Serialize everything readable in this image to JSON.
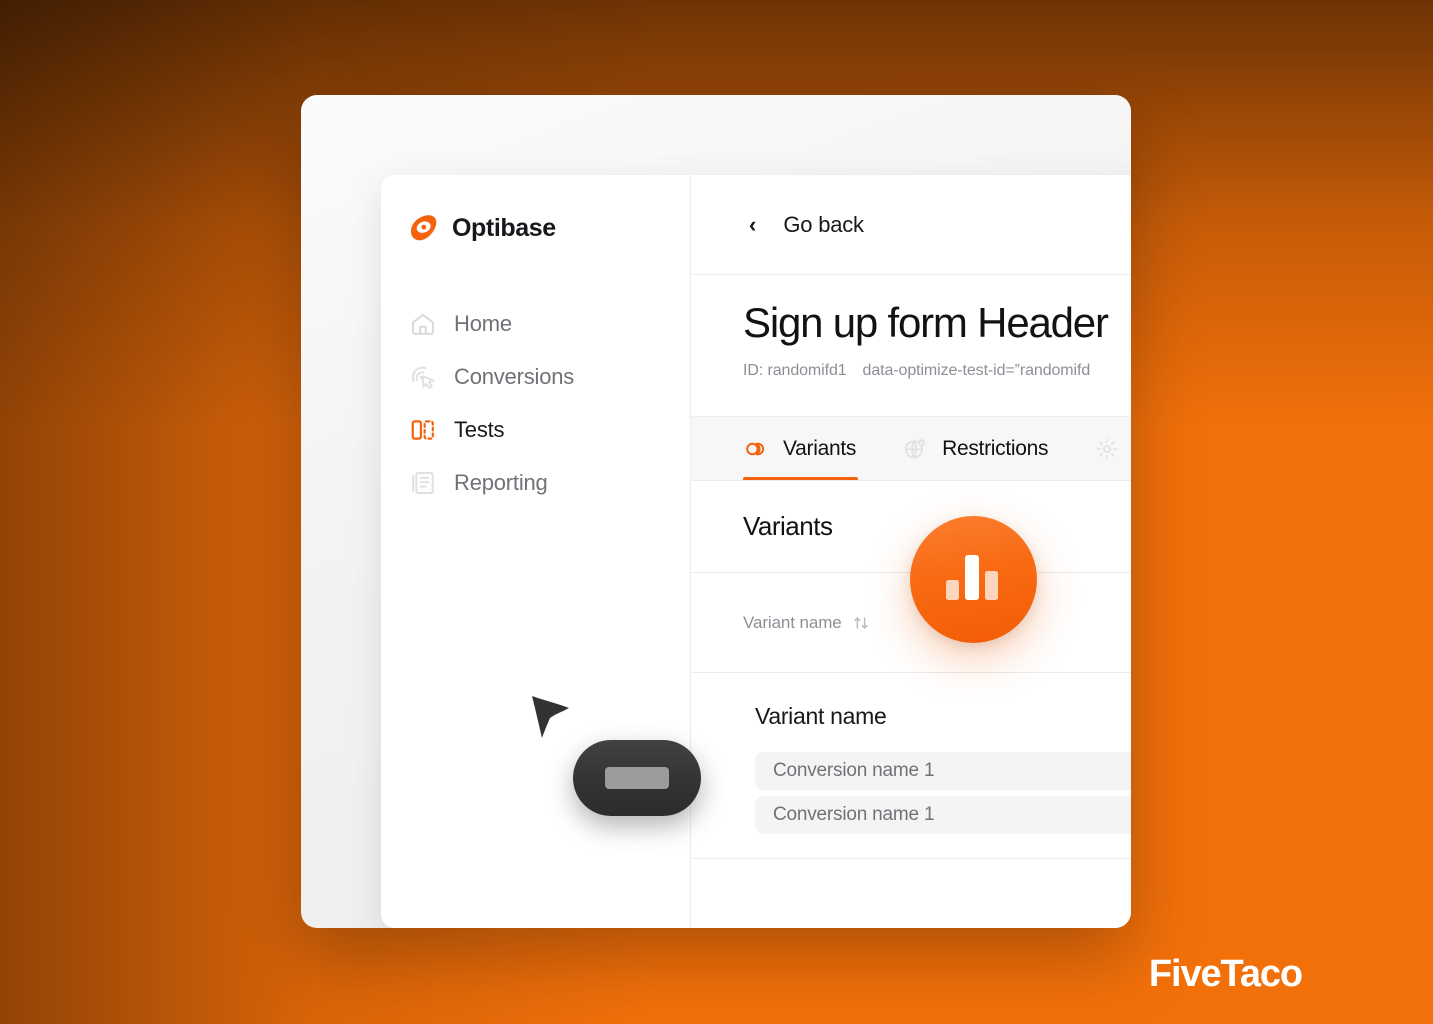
{
  "background": {
    "accent_orange": "#f4620d",
    "bright_orange": "#f97306",
    "dark": "#0a0502"
  },
  "brand": {
    "name": "Optibase",
    "logo_icon": "optibase-leaf-icon",
    "logo_color": "#f4620d"
  },
  "sidebar": {
    "items": [
      {
        "label": "Home",
        "icon": "home-icon",
        "active": false
      },
      {
        "label": "Conversions",
        "icon": "cursor-click-icon",
        "active": false
      },
      {
        "label": "Tests",
        "icon": "ab-test-icon",
        "active": true
      },
      {
        "label": "Reporting",
        "icon": "document-list-icon",
        "active": false
      }
    ]
  },
  "main": {
    "go_back": {
      "label": "Go back",
      "icon": "chevron-left-icon"
    },
    "title": "Sign up form Header",
    "subtitle": {
      "id_label": "ID: randomifd1",
      "attribute": "data-optimize-test-id=”randomifd"
    },
    "tabs": [
      {
        "label": "Variants",
        "icon": "variants-icon",
        "active": true
      },
      {
        "label": "Restrictions",
        "icon": "globe-pin-icon",
        "active": false
      },
      {
        "label": "",
        "icon": "gear-icon",
        "active": false
      }
    ],
    "section": {
      "title": "Variants",
      "column_header": "Variant name",
      "sort_icon": "sort-updown-icon",
      "row_group_title": "Variant name",
      "rows": [
        {
          "label": "Conversion name 1"
        },
        {
          "label": "Conversion name 1"
        }
      ]
    }
  },
  "overlays": {
    "badge_icon": "bar-chart-icon",
    "cursor_icon": "mouse-pointer-icon",
    "tooltip_pill": "loading-pill"
  },
  "watermark": {
    "text": "FiveTaco"
  }
}
